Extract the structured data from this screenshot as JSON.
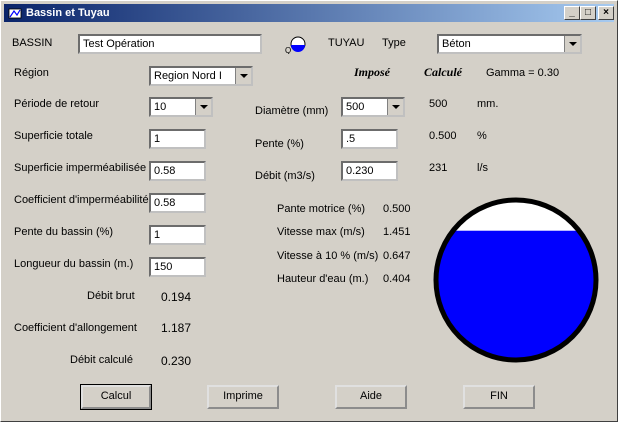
{
  "window": {
    "title": "Bassin et Tuyau"
  },
  "bassin": {
    "label": "BASSIN",
    "name": "Test Opération",
    "region_label": "Région",
    "region": "Region Nord I",
    "periode_label": "Période de retour",
    "periode": "10",
    "superficie_label": "Superficie totale",
    "superficie": "1",
    "imper_label": "Superficie imperméabilisée",
    "imper": "0.58",
    "coef_imper_label": "Coefficient d'imperméabilité",
    "coef_imper": "0.58",
    "pente_label": "Pente du bassin (%)",
    "pente": "1",
    "longueur_label": "Longueur du bassin (m.)",
    "longueur": "150",
    "debit_brut_label": "Débit brut",
    "debit_brut": "0.194",
    "coef_allong_label": "Coefficient d'allongement",
    "coef_allong": "1.187",
    "debit_calc_label": "Débit calculé",
    "debit_calc": "0.230"
  },
  "tuyau": {
    "label": "TUYAU",
    "type_label": "Type",
    "type": "Béton",
    "impose_label": "Imposé",
    "calcule_label": "Calculé",
    "gamma": "Gamma = 0.30",
    "diametre_label": "Diamètre (mm)",
    "diametre": "500",
    "diametre_calc": "500",
    "diametre_unit": "mm.",
    "pente_label": "Pente (%)",
    "pente": ".5",
    "pente_calc": "0.500",
    "pente_unit": "%",
    "debit_label": "Débit (m3/s)",
    "debit": "0.230",
    "debit_calc": "231",
    "debit_unit": "l/s",
    "pante_motrice_label": "Pante motrice (%)",
    "pante_motrice": "0.500",
    "vitesse_max_label": "Vitesse max (m/s)",
    "vitesse_max": "1.451",
    "vitesse10_label": "Vitesse à 10 % (m/s)",
    "vitesse10": "0.647",
    "hauteur_label": "Hauteur d'eau (m.)",
    "hauteur": "0.404"
  },
  "pipe_fill_fraction": 0.808,
  "colors": {
    "water": "#0000ff",
    "titlebar": "#0a246a"
  },
  "buttons": {
    "calcul": "Calcul",
    "imprime": "Imprime",
    "aide": "Aide",
    "fin": "FIN"
  }
}
